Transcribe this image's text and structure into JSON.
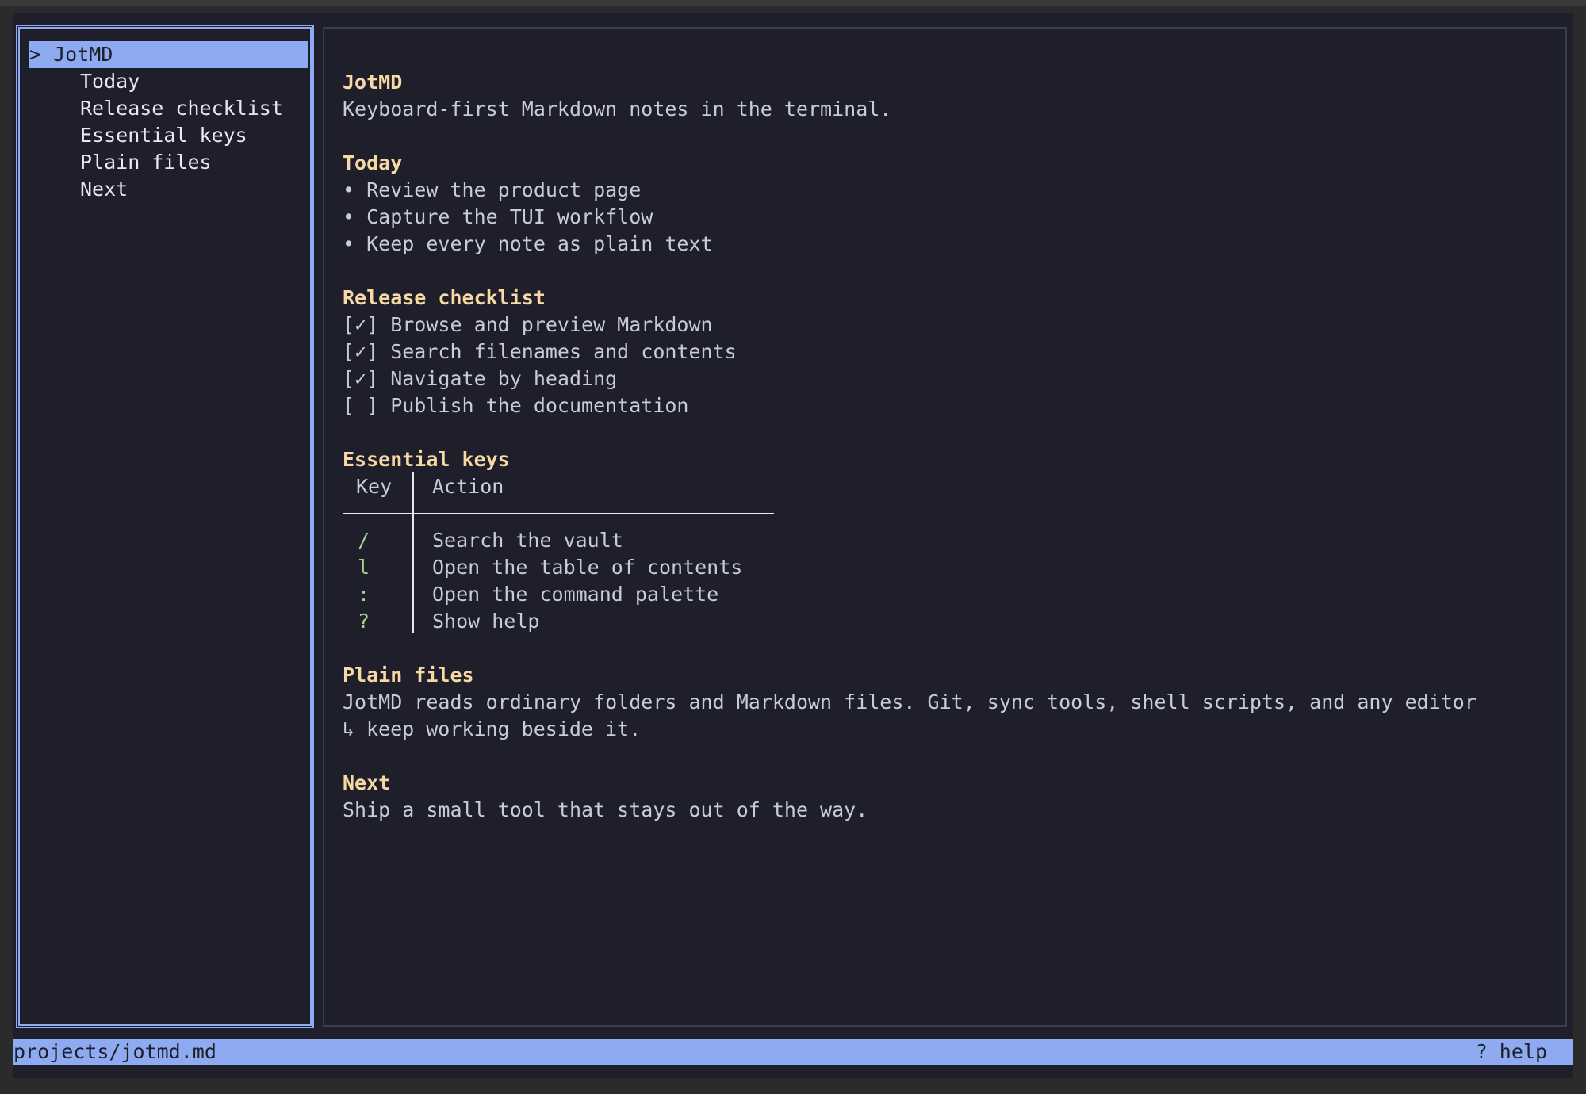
{
  "sidebar": {
    "selected_prefix": "> ",
    "items": [
      {
        "label": "JotMD",
        "selected": true
      },
      {
        "label": "Today"
      },
      {
        "label": "Release checklist"
      },
      {
        "label": "Essential keys"
      },
      {
        "label": "Plain files"
      },
      {
        "label": "Next"
      }
    ]
  },
  "document": {
    "title": "JotMD",
    "subtitle": "Keyboard-first Markdown notes in the terminal.",
    "today": {
      "heading": "Today",
      "bullets": [
        "• Review the product page",
        "• Capture the TUI workflow",
        "• Keep every note as plain text"
      ]
    },
    "checklist": {
      "heading": "Release checklist",
      "items": [
        "[✓] Browse and preview Markdown",
        "[✓] Search filenames and contents",
        "[✓] Navigate by heading",
        "[ ] Publish the documentation"
      ]
    },
    "keys": {
      "heading": "Essential keys",
      "col_key": "Key",
      "col_action": "Action",
      "rows": [
        {
          "key": "/",
          "action": "Search the vault"
        },
        {
          "key": "l",
          "action": "Open the table of contents"
        },
        {
          "key": ":",
          "action": "Open the command palette"
        },
        {
          "key": "?",
          "action": "Show help"
        }
      ]
    },
    "plain_files": {
      "heading": "Plain files",
      "line1": "JotMD reads ordinary folders and Markdown files. Git, sync tools, shell scripts, and any editor",
      "wrap_glyph": "↳",
      "line2": "keep working beside it."
    },
    "next": {
      "heading": "Next",
      "text": "Ship a small tool that stays out of the way."
    }
  },
  "status_bar": {
    "path": "projects/jotmd.md",
    "help": "? help"
  },
  "colors": {
    "background": "#1f1f2c",
    "accent": "#8eaaf0",
    "heading": "#f7d9a3",
    "key": "#a5d68d",
    "text": "#c9cbd6"
  }
}
